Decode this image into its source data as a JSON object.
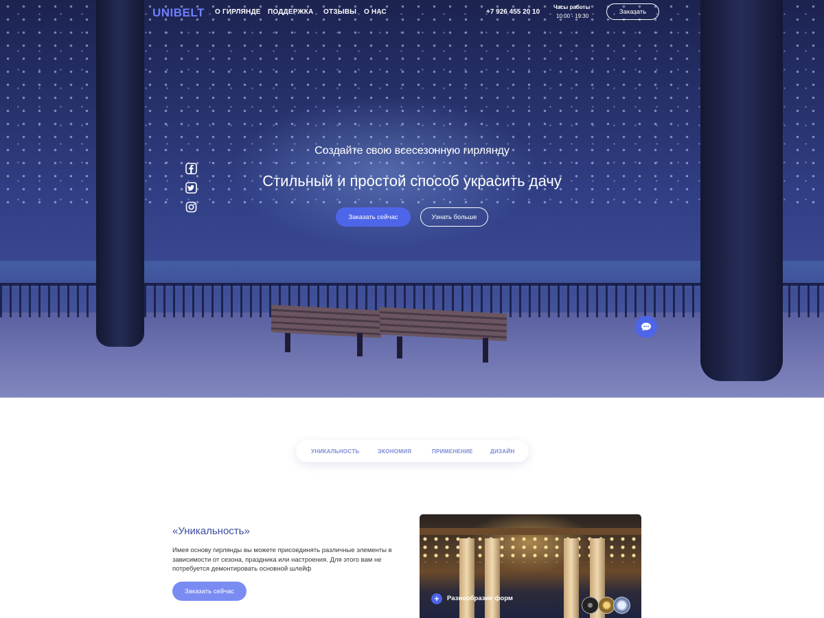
{
  "nav": {
    "logo": "UNIBELT",
    "links": [
      "О ГИРЛЯНДЕ",
      "ПОДДЕРЖКА",
      "ОТЗЫВЫ",
      "О НАС"
    ],
    "phone": "+7 926 455 20 10",
    "hours_title": "Часы работы",
    "hours_time": "10:00 - 19:30",
    "order_label": "Заказать"
  },
  "social": [
    "facebook-icon",
    "twitter-icon",
    "instagram-icon"
  ],
  "hero": {
    "subtitle": "Создайте свою всесезонную гирлянду",
    "title": "Стильный и простой способ украсить дачу",
    "primary_button": "Заказать сейчас",
    "secondary_button": "Узнать больше"
  },
  "tabs": [
    "УНИКАЛЬНОСТЬ",
    "ЭКОНОМИЯ",
    "ПРИМЕНЕНИЕ",
    "ДИЗАЙН"
  ],
  "feature": {
    "title": "«Уникальность»",
    "text": "Имея основу гирлянды вы можете присоединять различные элементы в зависимости от сезона, праздника или настроения. Для этого вам не потребуется демонтировать основной шлейф",
    "button": "Заказать сейчас",
    "image_caption": "Разнообразие форм"
  },
  "colors": {
    "accent": "#4d65e8",
    "tab_text": "#7d8bd6",
    "feature_title": "#3a4a9e"
  }
}
